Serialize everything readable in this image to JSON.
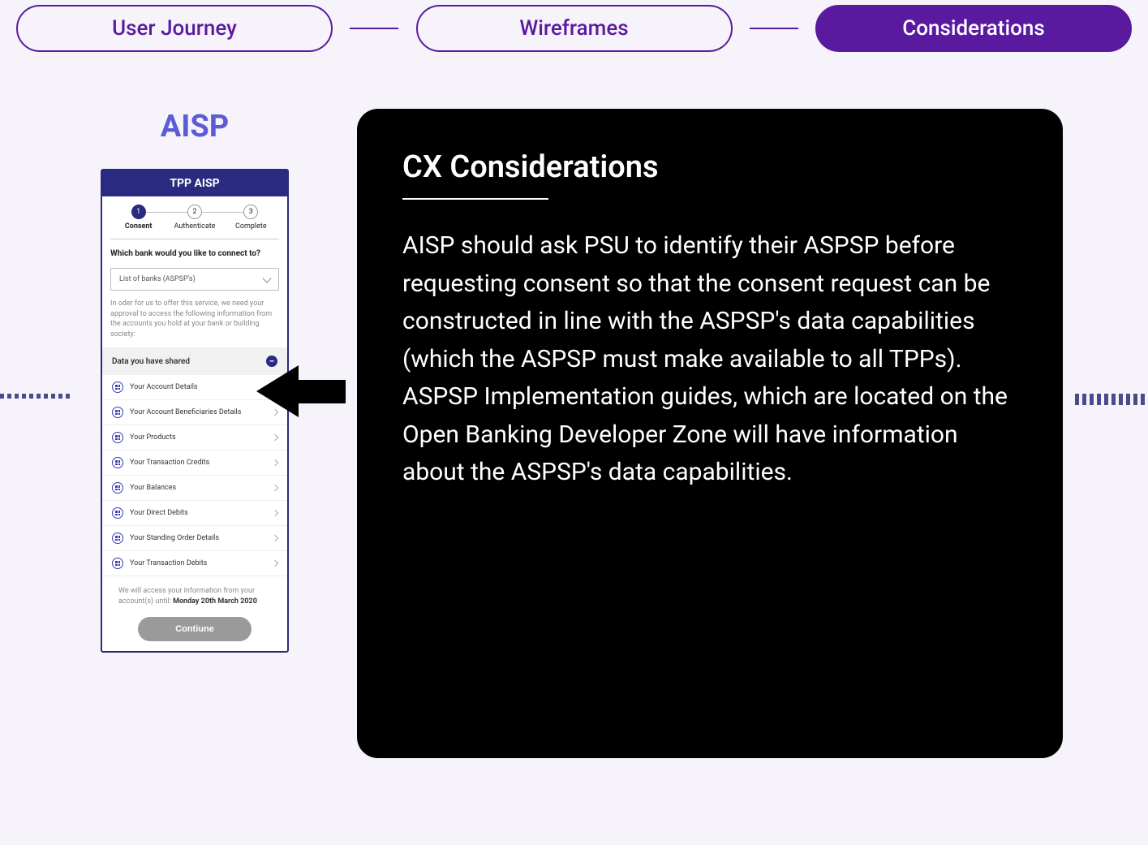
{
  "tabs": {
    "user_journey": "User Journey",
    "wireframes": "Wireframes",
    "considerations": "Considerations"
  },
  "aisp_title": "AISP",
  "phone": {
    "header": "TPP AISP",
    "steps": [
      {
        "num": "1",
        "label": "Consent"
      },
      {
        "num": "2",
        "label": "Authenticate"
      },
      {
        "num": "3",
        "label": "Complete"
      }
    ],
    "question": "Which bank would you like to connect to?",
    "select_placeholder": "List of banks (ASPSP's)",
    "info": "In oder for us to offer this service, we need your approval to access the following information from the accounts you hold at your bank or building society:",
    "shared_header": "Data you have shared",
    "rows": [
      "Your Account Details",
      "Your Account Beneficiaries Details",
      "Your Products",
      "Your Transaction Credits",
      "Your Balances",
      "Your Direct Debits",
      "Your Standing Order Details",
      "Your Transaction Debits"
    ],
    "access_note_pre": "We will access your information from your account(s) until: ",
    "access_note_date": "Monday 20th March 2020",
    "continue": "Contiune"
  },
  "cx": {
    "title": "CX Considerations",
    "body": "AISP should ask PSU to identify their ASPSP before requesting consent so that the consent request can be constructed in line with the ASPSP's data capabilities (which the ASPSP must make available to all TPPs). ASPSP Implementation guides, which are located on the Open Banking Developer Zone will have information about the ASPSP's data capabilities."
  }
}
